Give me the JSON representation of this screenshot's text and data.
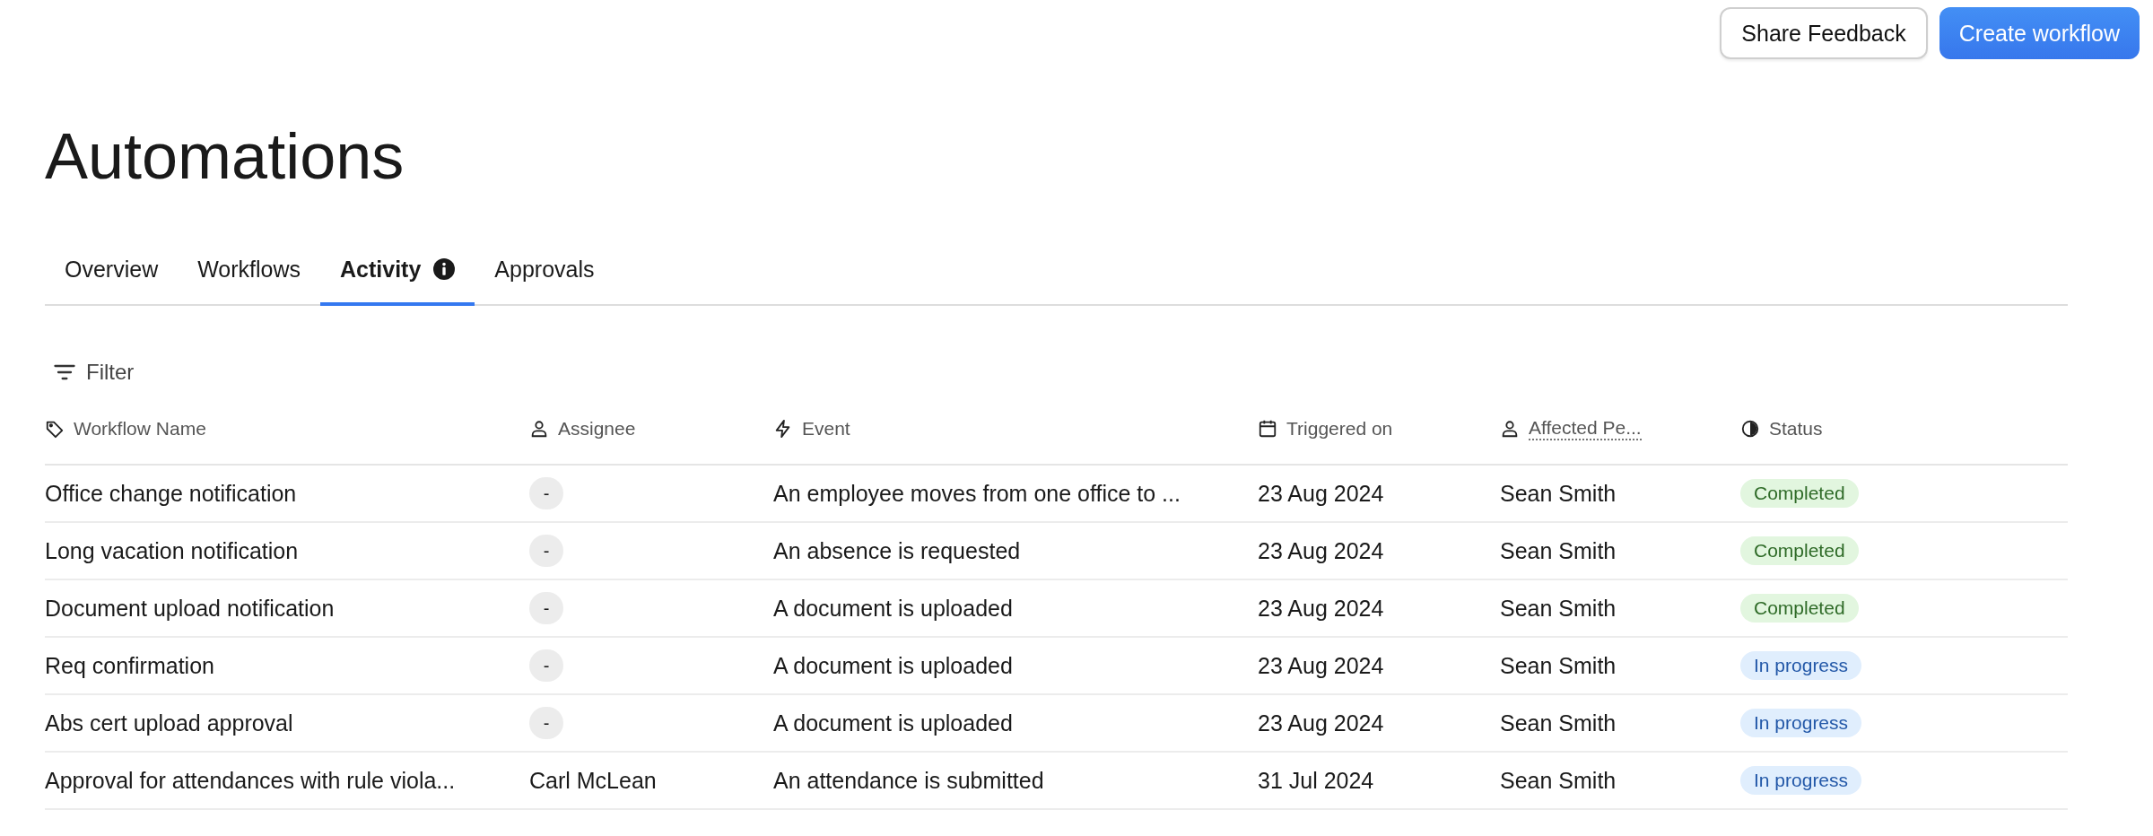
{
  "actions": [
    {
      "label": "Share Feedback",
      "kind": "secondary"
    },
    {
      "label": "Create workflow",
      "kind": "primary"
    }
  ],
  "title": "Automations",
  "tabs": [
    {
      "label": "Overview",
      "selected": false,
      "info_icon": false
    },
    {
      "label": "Workflows",
      "selected": false,
      "info_icon": false
    },
    {
      "label": "Activity",
      "selected": true,
      "info_icon": true
    },
    {
      "label": "Approvals",
      "selected": false,
      "info_icon": false
    }
  ],
  "filter": {
    "label": "Filter"
  },
  "table": {
    "columns": [
      {
        "label": "Workflow Name",
        "dotted_underline": false
      },
      {
        "label": "Assignee",
        "dotted_underline": false
      },
      {
        "label": "Event",
        "dotted_underline": false
      },
      {
        "label": "Triggered on",
        "dotted_underline": false
      },
      {
        "label": "Affected Pe...",
        "dotted_underline": true
      },
      {
        "label": "Status",
        "dotted_underline": false
      }
    ],
    "rows": [
      {
        "name": "Office change notification",
        "assignee": {
          "text": "-",
          "kind": "empty"
        },
        "event": "An employee moves from one office to ...",
        "triggered_on": "23 Aug 2024",
        "affected_person": "Sean Smith",
        "status": {
          "text": "Completed",
          "kind": "completed"
        }
      },
      {
        "name": "Long vacation notification",
        "assignee": {
          "text": "-",
          "kind": "empty"
        },
        "event": "An absence is requested",
        "triggered_on": "23 Aug 2024",
        "affected_person": "Sean Smith",
        "status": {
          "text": "Completed",
          "kind": "completed"
        }
      },
      {
        "name": "Document upload notification",
        "assignee": {
          "text": "-",
          "kind": "empty"
        },
        "event": "A document is uploaded",
        "triggered_on": "23 Aug 2024",
        "affected_person": "Sean Smith",
        "status": {
          "text": "Completed",
          "kind": "completed"
        }
      },
      {
        "name": "Req confirmation",
        "assignee": {
          "text": "-",
          "kind": "empty"
        },
        "event": "A document is uploaded",
        "triggered_on": "23 Aug 2024",
        "affected_person": "Sean Smith",
        "status": {
          "text": "In progress",
          "kind": "in_progress"
        }
      },
      {
        "name": "Abs cert upload approval",
        "assignee": {
          "text": "-",
          "kind": "empty"
        },
        "event": "A document is uploaded",
        "triggered_on": "23 Aug 2024",
        "affected_person": "Sean Smith",
        "status": {
          "text": "In progress",
          "kind": "in_progress"
        }
      },
      {
        "name": "Approval for attendances with rule viola...",
        "assignee": {
          "text": "Carl McLean",
          "kind": "person"
        },
        "event": "An attendance is submitted",
        "triggered_on": "31 Jul 2024",
        "affected_person": "Sean Smith",
        "status": {
          "text": "In progress",
          "kind": "in_progress"
        }
      }
    ]
  }
}
